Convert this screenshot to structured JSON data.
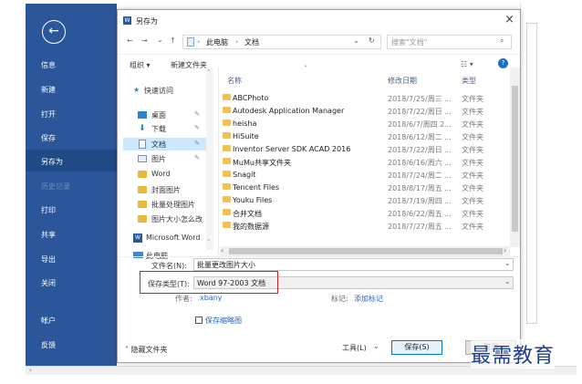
{
  "backstage": {
    "back_glyph": "←",
    "items": [
      "信息",
      "新建",
      "打开",
      "保存",
      "另存为",
      "历史记录",
      "打印",
      "共享",
      "导出",
      "关闭",
      "帐户",
      "反馈"
    ],
    "selected_index": 4,
    "colors": {
      "bg": "#2b579a",
      "selected": "#1f4a85"
    }
  },
  "dialog": {
    "title": "另存为",
    "close_glyph": "×",
    "nav": {
      "back": "←",
      "forward": "→",
      "down": "⌄",
      "up": "↑"
    },
    "address": {
      "root": "此电脑",
      "sep": "›",
      "current": "文档",
      "dropdown": "⌄",
      "refresh": "↻"
    },
    "search_placeholder": "搜索\"文档\"",
    "search_icon": "⌕",
    "organize": "组织 ▾",
    "new_folder": "新建文件夹",
    "view_glyph": "☷ ▾",
    "help_glyph": "?",
    "nav_pane": {
      "scroll_up": "˄",
      "scroll_down": "˅",
      "quick_access": "快速访问",
      "items": [
        "桌面",
        "下载",
        "文档",
        "图片",
        "Word",
        "封面图片",
        "批量处理图片",
        "图片大小怎么改",
        "Microsoft Word",
        "此电脑"
      ]
    },
    "file_list": {
      "headers": {
        "sort": "˄",
        "name": "名称",
        "date": "修改日期",
        "type": "类型"
      },
      "rows": [
        {
          "name": "ABCPhoto",
          "date": "2018/7/25/周三 ...",
          "type": "文件夹"
        },
        {
          "name": "Autodesk Application Manager",
          "date": "2018/7/22/周日 ...",
          "type": "文件夹"
        },
        {
          "name": "heisha",
          "date": "2018/6/7/周四 2...",
          "type": "文件夹"
        },
        {
          "name": "HiSuite",
          "date": "2018/6/12/周二 ...",
          "type": "文件夹"
        },
        {
          "name": "Inventor Server SDK ACAD 2016",
          "date": "2018/7/22/周日 ...",
          "type": "文件夹"
        },
        {
          "name": "MuMu共享文件夹",
          "date": "2018/6/16/周六 ...",
          "type": "文件夹"
        },
        {
          "name": "Snagit",
          "date": "2018/7/24/周二 ...",
          "type": "文件夹"
        },
        {
          "name": "Tencent Files",
          "date": "2018/8/17/周五 ...",
          "type": "文件夹"
        },
        {
          "name": "Youku Files",
          "date": "2018/7/19/周四 ...",
          "type": "文件夹"
        },
        {
          "name": "合并文档",
          "date": "2018/6/22/周五 ...",
          "type": "文件夹"
        },
        {
          "name": "我的数据源",
          "date": "2018/7/27/周五 ...",
          "type": "文件夹"
        }
      ]
    },
    "hscroll": {
      "left": "‹",
      "right": "›"
    },
    "filename_label": "文件名(N):",
    "filename_value": "批量更改图片大小",
    "dropdown_glyph": "⌄",
    "filetype_label": "保存类型(T):",
    "filetype_value": "Word 97-2003 文档",
    "author_label": "作者:",
    "author_value": "xbany",
    "tags_label": "标记:",
    "tags_value": "添加标记",
    "thumbnail_label": "保存缩略图",
    "hide_folders": "˄ 隐藏文件夹",
    "tools_label": "工具(L)",
    "save_label": "保存(S)",
    "cancel_label": "取消",
    "highlight_color": "#d21f1f"
  },
  "hscroll_arrow": "‹",
  "watermark": "最需教育"
}
